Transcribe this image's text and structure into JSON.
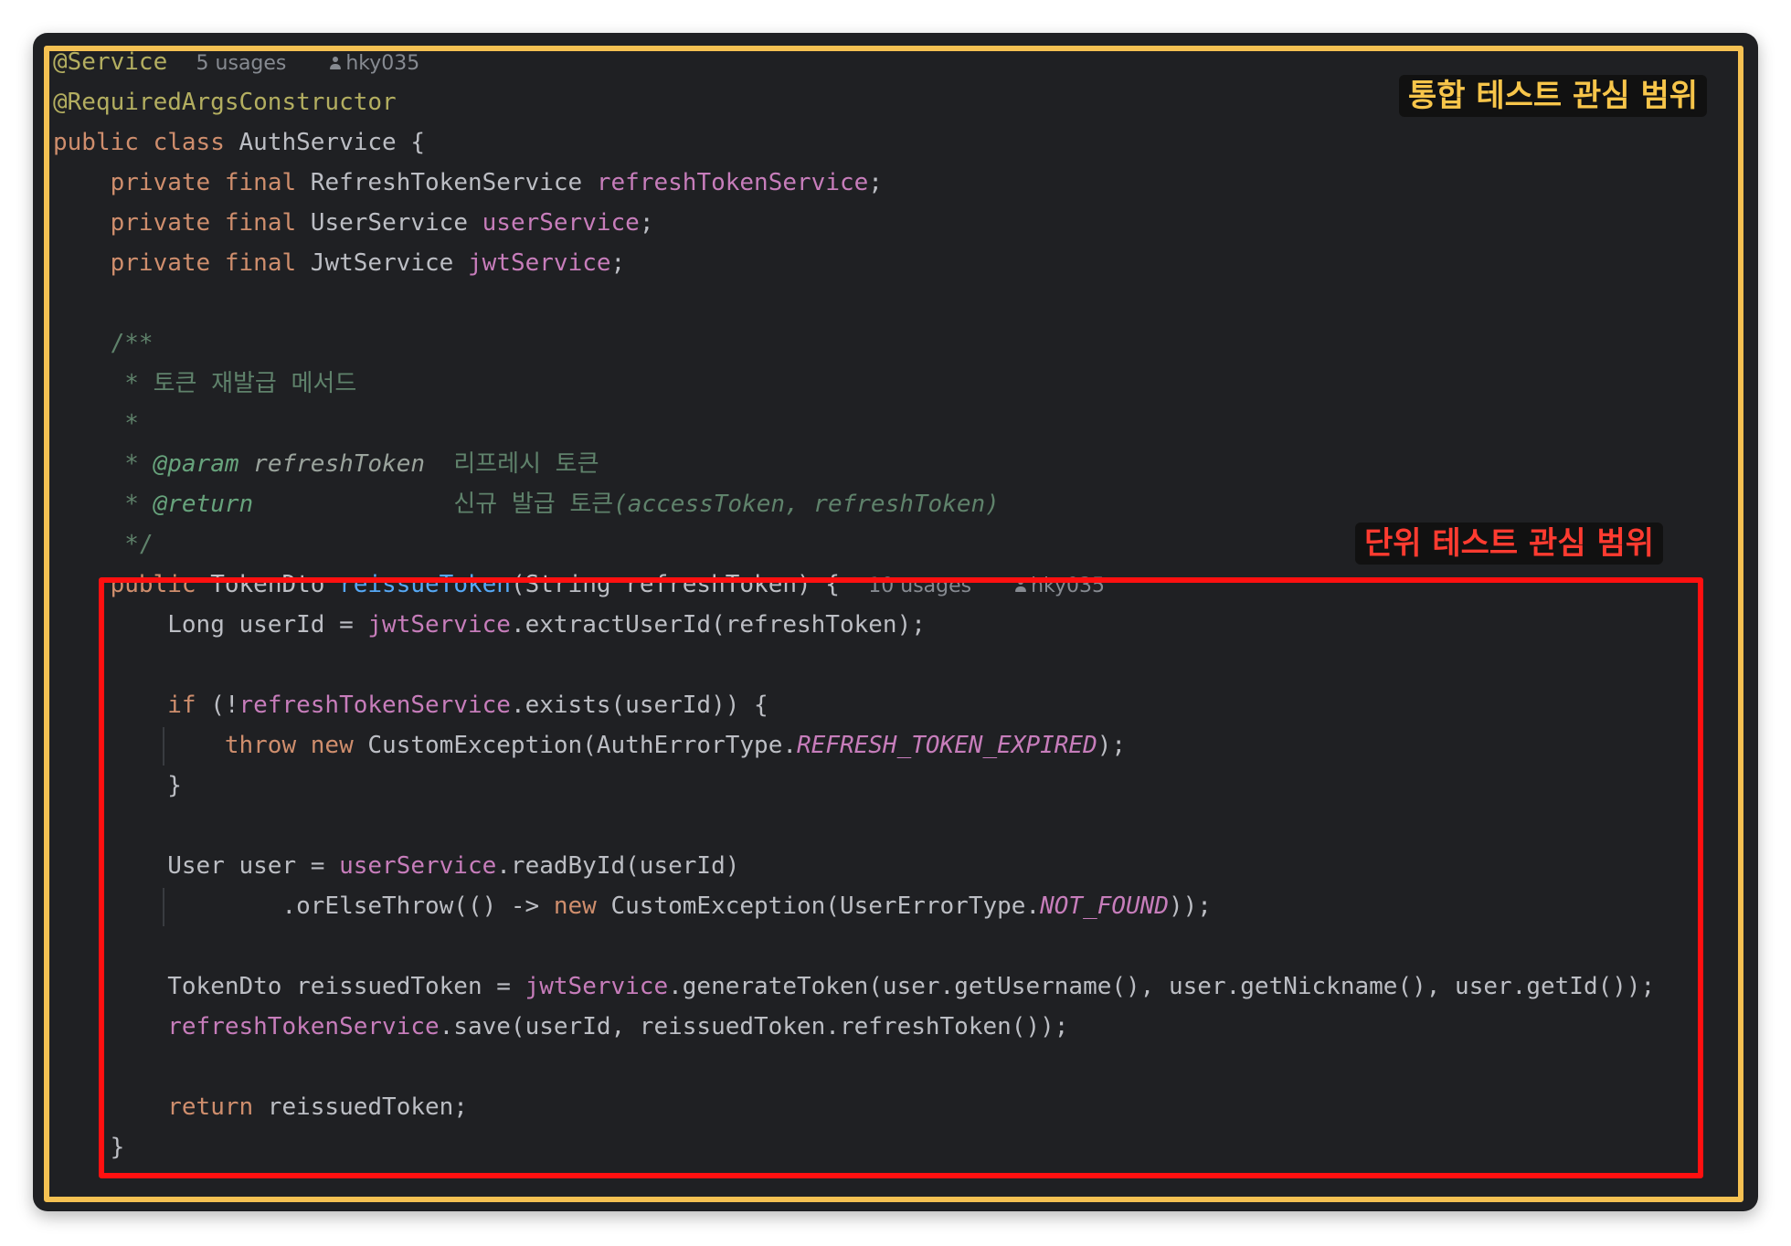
{
  "labels": {
    "integration": "통합 테스트 관심 범위",
    "unit": "단위 테스트 관심 범위"
  },
  "code": {
    "annotation_service": "@Service",
    "service_usages": "5 usages",
    "service_author": "hky035",
    "annotation_rac": "@RequiredArgsConstructor",
    "kw_public": "public",
    "kw_class": "class",
    "class_name": "AuthService",
    "kw_private": "private",
    "kw_final": "final",
    "fields": [
      {
        "type": "RefreshTokenService",
        "name": "refreshTokenService"
      },
      {
        "type": "UserService",
        "name": "userService"
      },
      {
        "type": "JwtService",
        "name": "jwtService"
      }
    ],
    "doc": {
      "open": "/**",
      "star": "*",
      "summary": "토큰 재발급 메서드",
      "param_tag": "@param",
      "param_name": "refreshToken",
      "param_desc": "리프레시 토큰",
      "return_tag": "@return",
      "return_desc_ko": "신규 발급 토큰",
      "return_desc_code": "(accessToken, refreshToken)",
      "close": "*/"
    },
    "method": {
      "return_type": "TokenDto",
      "name": "reissueToken",
      "params": "(String refreshToken) {",
      "usages": "10 usages",
      "author": "hky035"
    },
    "body": {
      "l1_a": "Long userId = ",
      "l1_field": "jwtService",
      "l1_b": ".extractUserId(refreshToken);",
      "kw_if": "if",
      "l2_a": " (!",
      "l2_field": "refreshTokenService",
      "l2_b": ".exists(userId)) {",
      "kw_throw": "throw",
      "kw_new": "new",
      "l3_a": " CustomException(AuthErrorType.",
      "l3_const": "REFRESH_TOKEN_EXPIRED",
      "l3_b": ");",
      "close_brace": "}",
      "l4_a": "User user = ",
      "l4_field": "userService",
      "l4_b": ".readById(userId)",
      "l5_a": ".orElseThrow(() -> ",
      "l5_b": " CustomException(UserErrorType.",
      "l5_const": "NOT_FOUND",
      "l5_c": "));",
      "l6_a": "TokenDto reissuedToken = ",
      "l6_field": "jwtService",
      "l6_b": ".generateToken(user.getUsername(), user.getNickname(), user.getId());",
      "l7_field": "refreshTokenService",
      "l7_b": ".save(userId, reissuedToken.refreshToken());",
      "kw_return": "return",
      "l8_b": " reissuedToken;"
    }
  },
  "colors": {
    "background": "#1f2023",
    "keyword": "#cf8e6d",
    "annotation": "#b3ae60",
    "field": "#c77dbb",
    "method": "#56a8f5",
    "doc": "#5f826b",
    "frame_integration": "#f5c152",
    "frame_unit": "#ff1010"
  }
}
